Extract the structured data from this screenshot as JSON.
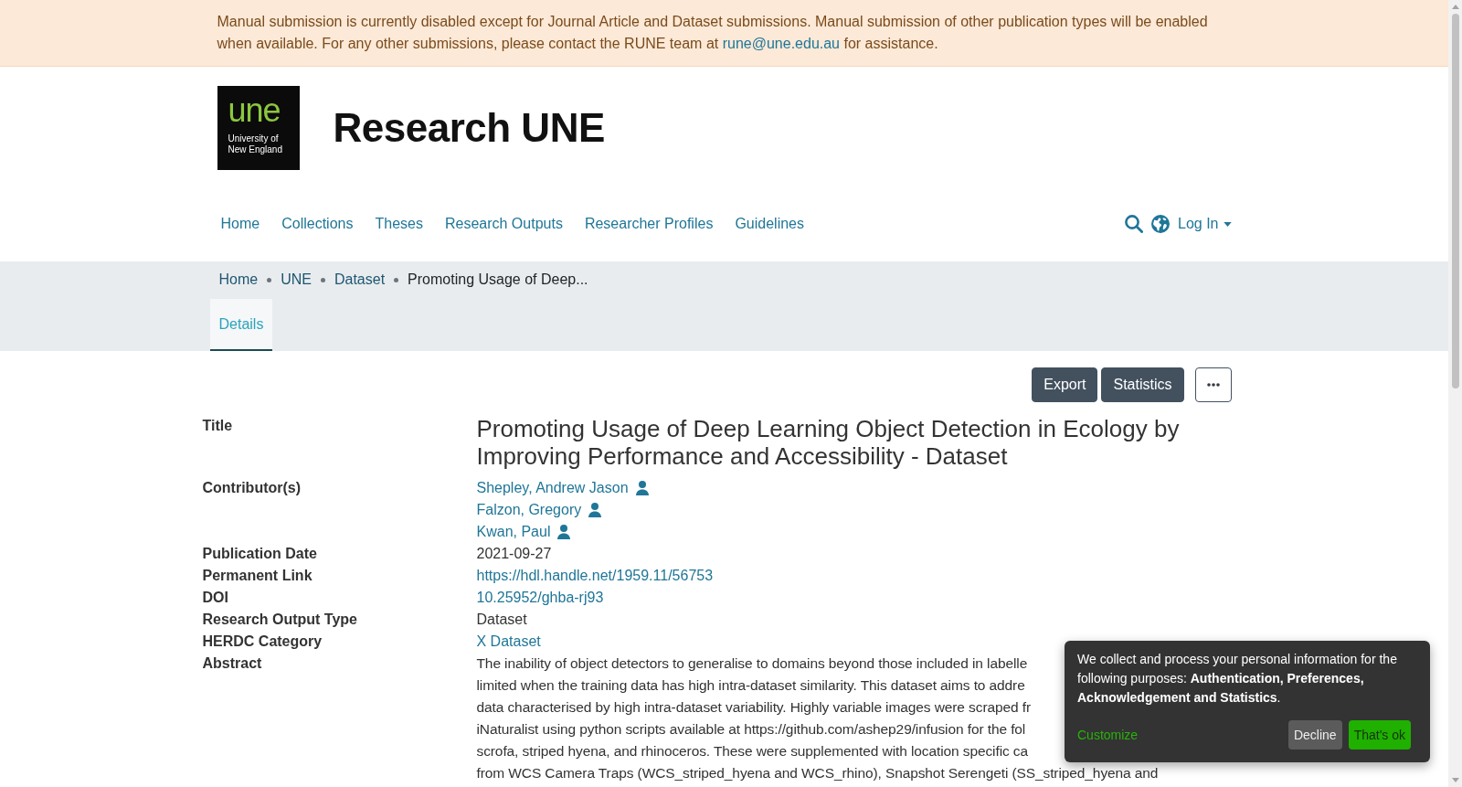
{
  "notice": {
    "text": "Manual submission is currently disabled except for Journal Article and Dataset submissions. Manual submission of other publication types will be enabled when available. For any other submissions, please contact the RUNE team at",
    "link": "rune@une.edu.au",
    "text_end": "for assistance."
  },
  "header": {
    "logo": {
      "wordmark": "une",
      "lines": [
        "University of",
        "New England"
      ]
    },
    "site_title": "Research UNE"
  },
  "nav": {
    "items": [
      "Home",
      "Collections",
      "Theses",
      "Research Outputs",
      "Researcher Profiles",
      "Guidelines"
    ],
    "login": "Log In"
  },
  "breadcrumb": {
    "links": [
      "Home",
      "UNE",
      "Dataset"
    ],
    "current": "Promoting Usage of Deep..."
  },
  "tabs": [
    {
      "label": "Details",
      "selected": true
    }
  ],
  "actions": {
    "buttons": [
      "Export",
      "Statistics"
    ]
  },
  "fields": [
    {
      "kind": "title",
      "label": "Title",
      "value": "Promoting Usage of Deep Learning Object Detection in Ecology by Improving Performance and Accessibility - Dataset"
    },
    {
      "kind": "people",
      "label": "Contributor(s)",
      "values": [
        "Shepley, Andrew Jason",
        "Falzon, Gregory",
        "Kwan, Paul"
      ]
    },
    {
      "kind": "text",
      "label": "Publication Date",
      "value": "2021-09-27"
    },
    {
      "kind": "link",
      "label": "Permanent Link",
      "value": "https://hdl.handle.net/1959.11/56753"
    },
    {
      "kind": "link",
      "label": "DOI",
      "value": "10.25952/ghba-rj93"
    },
    {
      "kind": "text",
      "label": "Research Output Type",
      "value": "Dataset"
    },
    {
      "kind": "link",
      "label": "HERDC Category",
      "value": "X Dataset"
    },
    {
      "kind": "lines",
      "label": "Abstract",
      "lines": [
        "The inability of object detectors to generalise to domains beyond those included in labelle",
        "limited when the training data has high intra-dataset similarity. This dataset aims to addre",
        "data characterised by high intra-dataset variability. Highly variable images were scraped fr",
        "iNaturalist using python scripts available at https://github.com/ashep29/infusion for the fol",
        "scrofa, striped hyena, and rhinoceros. These were supplemented with location specific ca",
        "from WCS Camera Traps (WCS_striped_hyena and WCS_rhino), Snapshot Serengeti (SS_striped_hyena and"
      ]
    }
  ],
  "cookie_notice": {
    "text": "We collect and process your personal information for the following purposes: **Authentication, Preferences, Acknowledgement and Statistics**.",
    "customize": "Customize",
    "decline": "Decline",
    "accept": "That's ok"
  }
}
